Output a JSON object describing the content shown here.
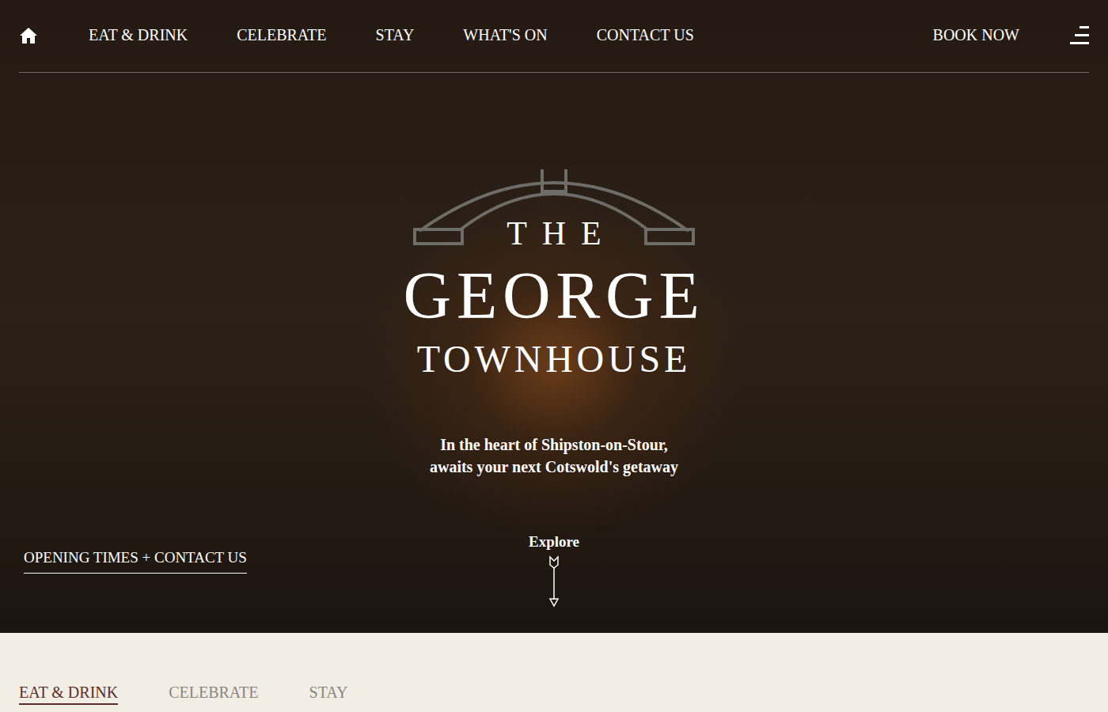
{
  "nav": {
    "items": [
      {
        "label": "EAT & DRINK"
      },
      {
        "label": "CELEBRATE"
      },
      {
        "label": "STAY"
      },
      {
        "label": "WHAT'S ON"
      },
      {
        "label": "CONTACT US"
      }
    ],
    "cta": "BOOK NOW"
  },
  "logo": {
    "line1": "THE",
    "line2": "GEORGE",
    "line3": "TOWNHOUSE"
  },
  "tagline": [
    "In the heart of Shipston-on-Stour,",
    "awaits your next Cotswold's getaway"
  ],
  "explore": "Explore",
  "opening_link": "OPENING TIMES + CONTACT US",
  "section_tabs": [
    {
      "label": "EAT & DRINK",
      "selected": true
    },
    {
      "label": "CELEBRATE",
      "selected": false
    },
    {
      "label": "STAY",
      "selected": false
    }
  ]
}
